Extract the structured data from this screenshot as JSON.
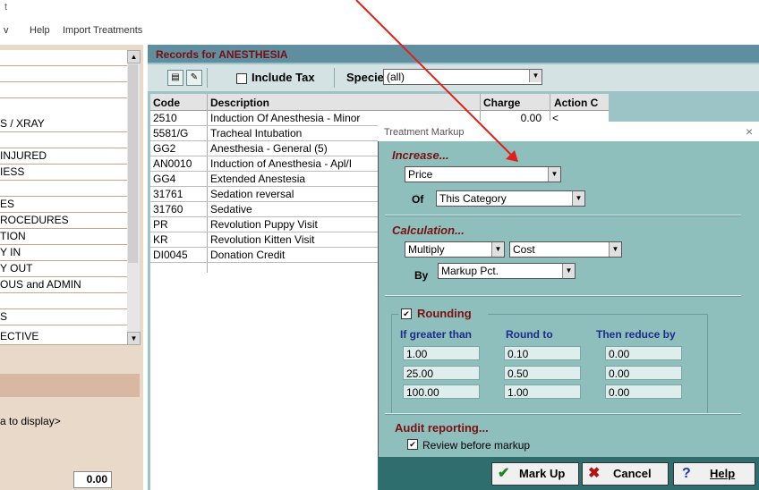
{
  "app": {
    "title_fragment": "t",
    "menu": [
      {
        "label": "v"
      },
      {
        "label": "Help"
      },
      {
        "label": "Import Treatments"
      }
    ]
  },
  "left_panel": {
    "categories": [
      "",
      "",
      "S / XRAY",
      "",
      "INJURED",
      "IESS",
      "",
      "ES",
      "ROCEDURES",
      "TION",
      "Y IN",
      "Y OUT",
      "OUS and ADMIN",
      "",
      "S",
      "ECTIVE"
    ],
    "no_data_text": "a to display>",
    "amount": "0.00"
  },
  "records": {
    "title": "Records for ANESTHESIA",
    "include_tax_label": "Include Tax",
    "species_label": "Species",
    "species_value": "(all)",
    "columns": [
      "Code",
      "Description",
      "Charge",
      "Action C"
    ],
    "rows": [
      {
        "code": "2510",
        "description": "Induction Of Anesthesia - Minor",
        "charge": "0.00",
        "action": "<"
      },
      {
        "code": "5581/G",
        "description": "Tracheal Intubation",
        "charge": "",
        "action": ""
      },
      {
        "code": "GG2",
        "description": "Anesthesia - General (5)",
        "charge": "",
        "action": ""
      },
      {
        "code": "AN0010",
        "description": "Induction of Anesthesia - Apl/I",
        "charge": "",
        "action": ""
      },
      {
        "code": "GG4",
        "description": "Extended Anestesia",
        "charge": "",
        "action": ""
      },
      {
        "code": "31761",
        "description": "Sedation reversal",
        "charge": "",
        "action": ""
      },
      {
        "code": "31760",
        "description": "Sedative",
        "charge": "",
        "action": ""
      },
      {
        "code": "PR",
        "description": "Revolution Puppy Visit",
        "charge": "",
        "action": ""
      },
      {
        "code": "KR",
        "description": "Revolution Kitten Visit",
        "charge": "",
        "action": ""
      },
      {
        "code": "DI0045",
        "description": "Donation Credit",
        "charge": "",
        "action": ""
      }
    ]
  },
  "dialog": {
    "title": "Treatment Markup",
    "close_glyph": "×",
    "increase": {
      "heading": "Increase...",
      "what": "Price",
      "of_label": "Of",
      "of_value": "This Category"
    },
    "calculation": {
      "heading": "Calculation...",
      "operation": "Multiply",
      "base": "Cost",
      "by_label": "By",
      "by_value": "Markup Pct."
    },
    "rounding": {
      "checked": true,
      "label": "Rounding",
      "headers": [
        "If greater than",
        "Round to",
        "Then reduce by"
      ],
      "rows": [
        [
          "1.00",
          "0.10",
          "0.00"
        ],
        [
          "25.00",
          "0.50",
          "0.00"
        ],
        [
          "100.00",
          "1.00",
          "0.00"
        ]
      ]
    },
    "audit": {
      "heading": "Audit reporting...",
      "review_checked": true,
      "review_label": "Review before markup"
    },
    "buttons": {
      "markup": "Mark Up",
      "cancel": "Cancel",
      "help": "Help"
    }
  },
  "colors": {
    "annotation_arrow": "#e0201a",
    "dialog_bg": "#8ebfbd",
    "section_heading": "#7a1010",
    "rounding_header": "#1c2c8a"
  }
}
